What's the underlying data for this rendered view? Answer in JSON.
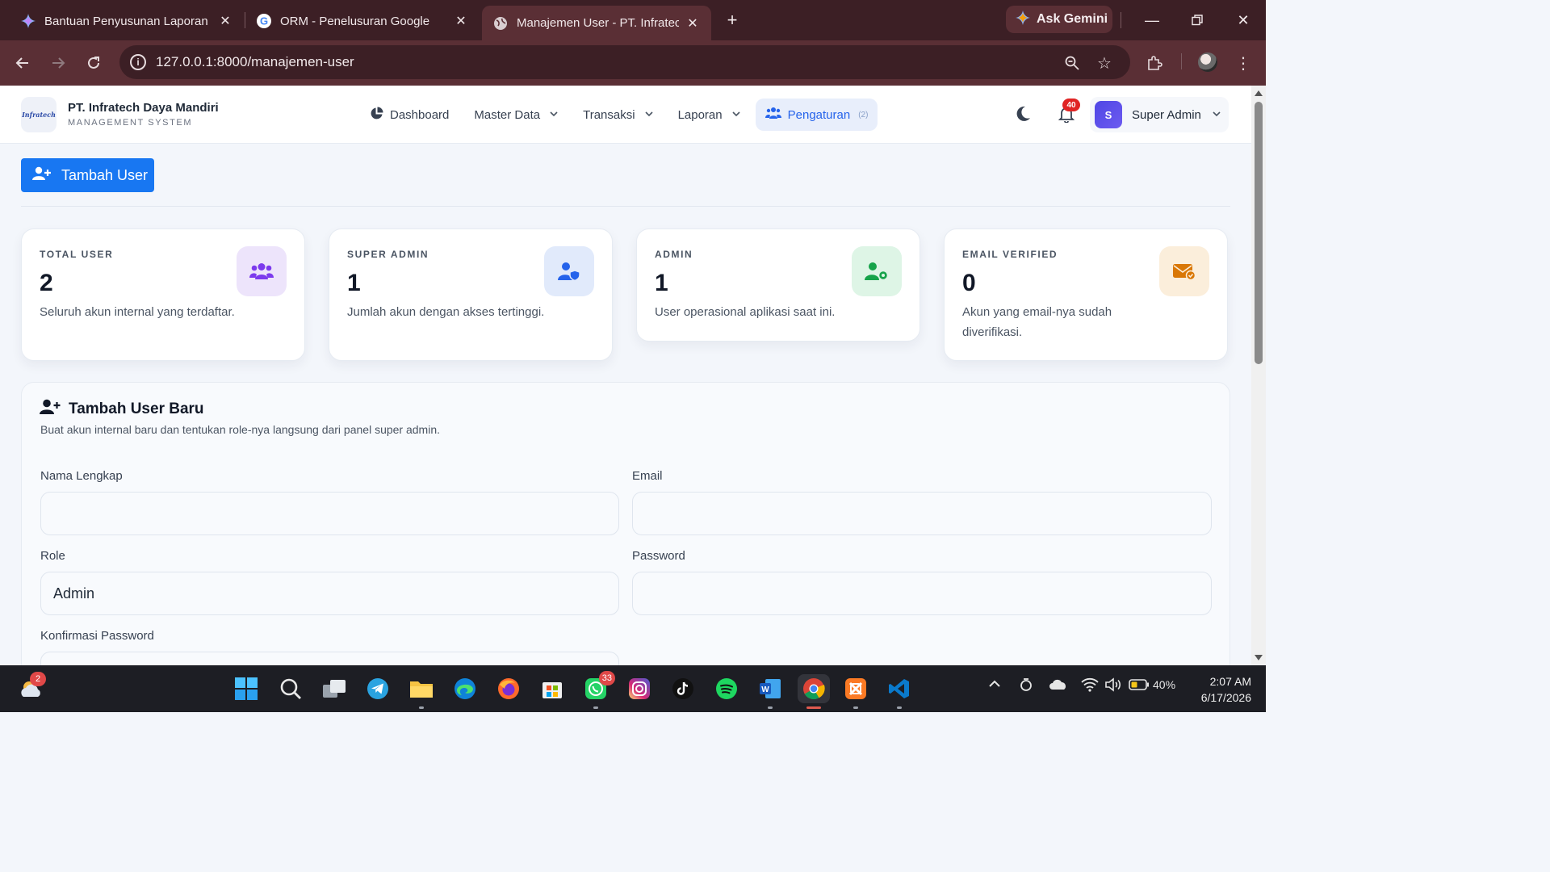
{
  "browser": {
    "tabs": [
      {
        "title": "Bantuan Penyusunan Laporan M"
      },
      {
        "title": "ORM - Penelusuran Google"
      },
      {
        "title": "Manajemen User - PT. Infratech"
      }
    ],
    "gemini_label": "Ask Gemini",
    "url": "127.0.0.1:8000/manajemen-user"
  },
  "app": {
    "logo_text": "Infratech",
    "brand_name": "PT. Infratech Daya Mandiri",
    "brand_sub": "MANAGEMENT SYSTEM",
    "menu": [
      {
        "label": "Dashboard",
        "dropdown": false
      },
      {
        "label": "Master Data",
        "dropdown": true
      },
      {
        "label": "Transaksi",
        "dropdown": true
      },
      {
        "label": "Laporan",
        "dropdown": true
      },
      {
        "label": "Pengaturan",
        "badge": "(2)",
        "active": true
      }
    ],
    "notifications_count": "40",
    "user": {
      "initial": "S",
      "name": "Super Admin"
    }
  },
  "page": {
    "add_button_label": "Tambah User",
    "stats": [
      {
        "label": "TOTAL USER",
        "value": "2",
        "desc": "Seluruh akun internal yang terdaftar.",
        "icon": "users-icon",
        "color": "#7c3aed",
        "bg": "#ede4fb"
      },
      {
        "label": "SUPER ADMIN",
        "value": "1",
        "desc": "Jumlah akun dengan akses tertinggi.",
        "icon": "user-shield-icon",
        "color": "#2563eb",
        "bg": "#e1eafb"
      },
      {
        "label": "ADMIN",
        "value": "1",
        "desc": "User operasional aplikasi saat ini.",
        "icon": "user-gear-icon",
        "color": "#16a34a",
        "bg": "#def5e6"
      },
      {
        "label": "EMAIL VERIFIED",
        "value": "0",
        "desc": "Akun yang email-nya sudah diverifikasi.",
        "icon": "envelope-check-icon",
        "color": "#d97706",
        "bg": "#fbeedb"
      }
    ],
    "form": {
      "title": "Tambah User Baru",
      "subtitle": "Buat akun internal baru dan tentukan role-nya langsung dari panel super admin.",
      "fields": {
        "name_label": "Nama Lengkap",
        "name_value": "",
        "email_label": "Email",
        "email_value": "",
        "role_label": "Role",
        "role_value": "Admin",
        "password_label": "Password",
        "password_value": "",
        "confirm_label": "Konfirmasi Password",
        "confirm_value": ""
      }
    }
  },
  "taskbar": {
    "weather_badge": "2",
    "whatsapp_badge": "33",
    "battery": "40%",
    "time": "2:07 AM",
    "date": "6/17/2026"
  }
}
